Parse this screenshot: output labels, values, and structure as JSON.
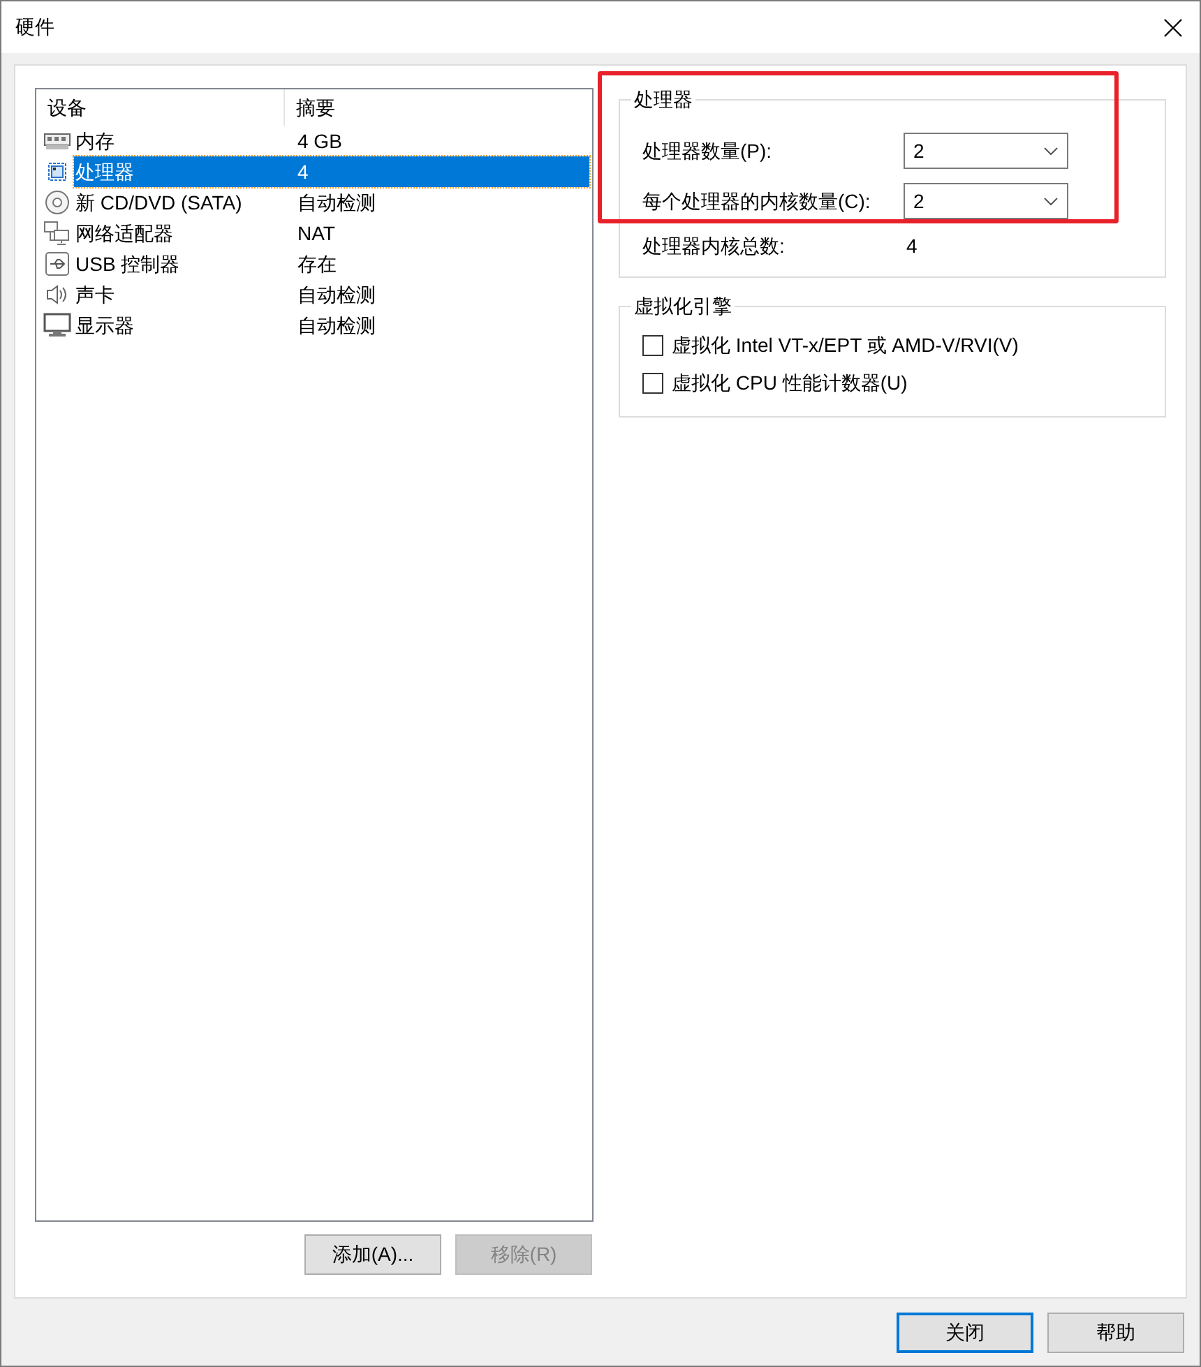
{
  "window": {
    "title": "硬件"
  },
  "device_list": {
    "columns": [
      "设备",
      "摘要"
    ],
    "rows": [
      {
        "kind": "memory",
        "device": "内存",
        "summary": "4 GB",
        "selected": false
      },
      {
        "kind": "cpu",
        "device": "处理器",
        "summary": "4",
        "selected": true
      },
      {
        "kind": "disc",
        "device": "新 CD/DVD (SATA)",
        "summary": "自动检测",
        "selected": false
      },
      {
        "kind": "network",
        "device": "网络适配器",
        "summary": "NAT",
        "selected": false
      },
      {
        "kind": "usb",
        "device": "USB 控制器",
        "summary": "存在",
        "selected": false
      },
      {
        "kind": "sound",
        "device": "声卡",
        "summary": "自动检测",
        "selected": false
      },
      {
        "kind": "display",
        "device": "显示器",
        "summary": "自动检测",
        "selected": false
      }
    ]
  },
  "list_buttons": [
    {
      "label": "添加(A)...",
      "disabled": false
    },
    {
      "label": "移除(R)",
      "disabled": true
    }
  ],
  "processor_group": {
    "title": "处理器",
    "fields": [
      {
        "label": "处理器数量(P):",
        "value": "2"
      },
      {
        "label": "每个处理器的内核数量(C):",
        "value": "2"
      }
    ],
    "total": {
      "label": "处理器内核总数:",
      "value": "4"
    }
  },
  "virtualization_group": {
    "title": "虚拟化引擎",
    "options": [
      {
        "label": "虚拟化 Intel VT-x/EPT 或 AMD-V/RVI(V)",
        "checked": false
      },
      {
        "label": "虚拟化 CPU 性能计数器(U)",
        "checked": false
      }
    ]
  },
  "dialog_buttons": [
    {
      "label": "关闭",
      "default": true
    },
    {
      "label": "帮助",
      "default": false
    }
  ],
  "annotation": {
    "kind": "rectangle",
    "color": "#e8202a"
  }
}
